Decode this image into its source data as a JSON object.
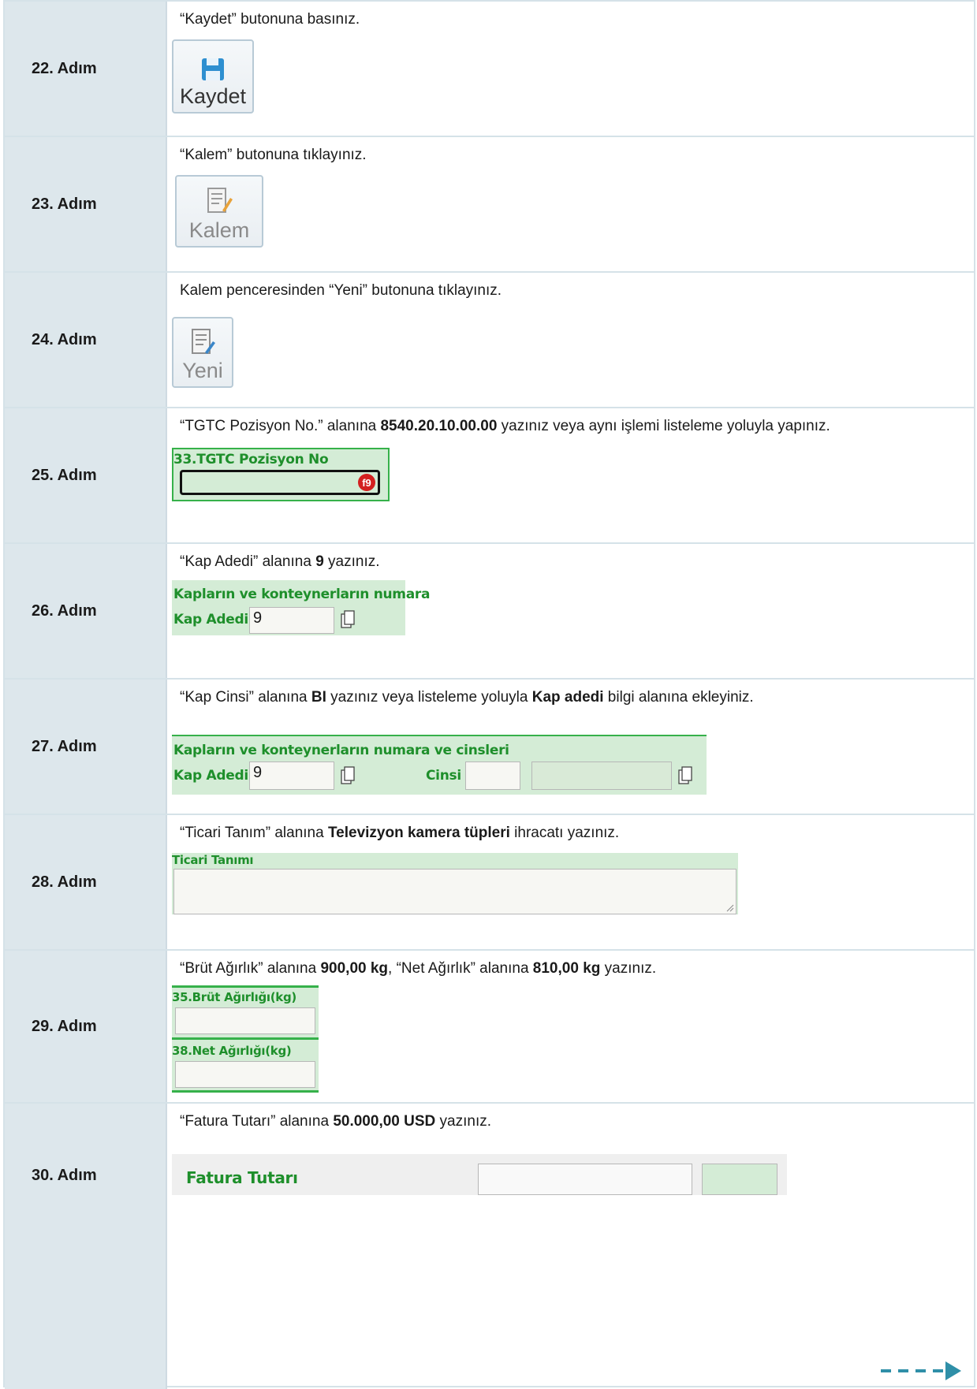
{
  "rows": [
    {
      "step": "22. Adım",
      "instr": [
        "“Kaydet” butonuna basınız."
      ],
      "button": "Kaydet"
    },
    {
      "step": "23. Adım",
      "instr": [
        "“Kalem” butonuna tıklayınız."
      ],
      "button": "Kalem"
    },
    {
      "step": "24. Adım",
      "instr": [
        "Kalem penceresinden “Yeni” butonuna tıklayınız."
      ],
      "button": "Yeni"
    },
    {
      "step": "25. Adım",
      "instr": [
        "“TGTC Pozisyon No.” alanına ",
        "8540.20.10.00.00",
        " yazınız veya aynı işlemi listeleme yoluyla yapınız."
      ],
      "field_label": "33.TGTC Pozisyon No",
      "badge": "f9"
    },
    {
      "step": "26. Adım",
      "instr": [
        "“Kap Adedi” alanına ",
        "9",
        " yazınız."
      ],
      "header": "Kapların ve konteynerların numara",
      "field_label": "Kap Adedi",
      "value": "9"
    },
    {
      "step": "27. Adım",
      "instr": [
        "“Kap Cinsi” alanına ",
        "BI",
        " yazınız veya listeleme yoluyla ",
        "Kap adedi",
        " bilgi alanına ekleyiniz."
      ],
      "header": "Kapların ve konteynerların numara ve cinsleri",
      "field_label": "Kap Adedi",
      "value": "9",
      "field_label2": "Cinsi"
    },
    {
      "step": "28. Adım",
      "instr": [
        "“Ticari Tanım” alanına ",
        "Televizyon kamera tüpleri",
        " ihracatı yazınız."
      ],
      "field_label": "Ticari Tanımı"
    },
    {
      "step": "29. Adım",
      "instr": [
        "“Brüt Ağırlık” alanına  ",
        "900,00 kg",
        ", “Net Ağırlık” alanına ",
        "810,00 kg",
        " yazınız."
      ],
      "field_label": "35.Brüt Ağırlığı(kg)",
      "field_label2": "38.Net Ağırlığı(kg)"
    },
    {
      "step": "30. Adım",
      "instr": [
        "“Fatura Tutarı” alanına ",
        "50.000,00 USD",
        " yazınız."
      ],
      "field_label": "Fatura Tutarı"
    }
  ],
  "colors": {
    "step_bg": "#dde7ec",
    "green_text": "#1e8f2b",
    "green_bg": "#d4ecd6",
    "arrow": "#2f8fa8"
  },
  "icons": [
    "save-icon",
    "document-edit-icon",
    "new-document-icon",
    "copy-icon",
    "dashed-arrow-right-icon"
  ]
}
